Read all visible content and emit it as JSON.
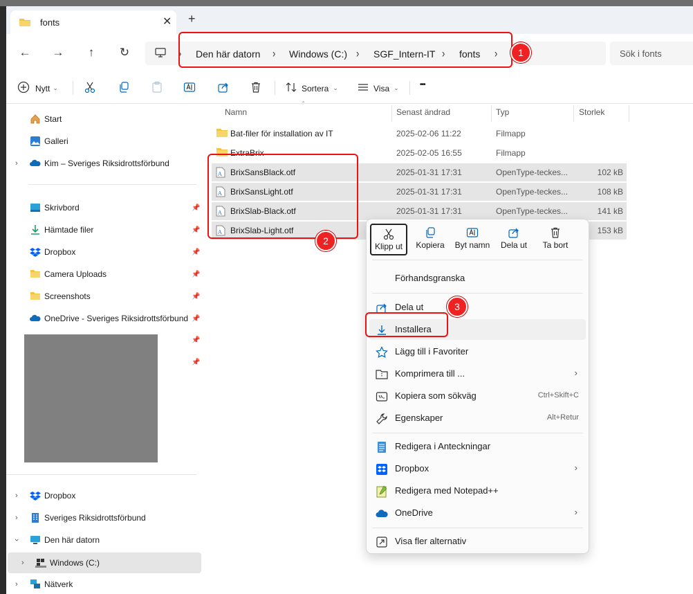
{
  "tab": {
    "title": "fonts",
    "close": "✕",
    "new": "+"
  },
  "address": {
    "crumbs": [
      "Den här datorn",
      "Windows (C:)",
      "SGF_Intern-IT",
      "fonts"
    ],
    "search_placeholder": "Sök i fonts"
  },
  "toolbar": {
    "new_label": "Nytt",
    "sort_label": "Sortera",
    "view_label": "Visa",
    "more": "•••"
  },
  "sidebar": {
    "items": [
      {
        "label": "Start",
        "icon": "home-icon"
      },
      {
        "label": "Galleri",
        "icon": "gallery-icon"
      },
      {
        "label": "Kim – Sveriges Riksidrottsförbund",
        "icon": "onedrive-icon"
      },
      {
        "label": "Skrivbord",
        "icon": "desktop-icon"
      },
      {
        "label": "Hämtade filer",
        "icon": "download-icon"
      },
      {
        "label": "Dropbox",
        "icon": "dropbox-icon"
      },
      {
        "label": "Camera Uploads",
        "icon": "folder-icon"
      },
      {
        "label": "Screenshots",
        "icon": "folder-icon"
      },
      {
        "label": "OneDrive - Sveriges Riksidrottsförbund",
        "icon": "onedrive-icon"
      },
      {
        "label": "Dropbox",
        "icon": "dropbox-icon"
      },
      {
        "label": "Sveriges Riksidrottsförbund",
        "icon": "building-icon"
      },
      {
        "label": "Den här datorn",
        "icon": "computer-icon"
      },
      {
        "label": "Windows (C:)",
        "icon": "drive-icon"
      },
      {
        "label": "Nätverk",
        "icon": "network-icon"
      }
    ]
  },
  "columns": {
    "name": "Namn",
    "modified": "Senast ändrad",
    "type": "Typ",
    "size": "Storlek"
  },
  "files": [
    {
      "name": "Bat-filer för installation av IT",
      "modified": "2025-02-06 11:22",
      "type": "Filmapp",
      "size": "",
      "kind": "folder"
    },
    {
      "name": "ExtraBrix",
      "modified": "2025-02-05 16:55",
      "type": "Filmapp",
      "size": "",
      "kind": "folder"
    },
    {
      "name": "BrixSansBlack.otf",
      "modified": "2025-01-31 17:31",
      "type": "OpenType-teckes...",
      "size": "102 kB",
      "kind": "font"
    },
    {
      "name": "BrixSansLight.otf",
      "modified": "2025-01-31 17:31",
      "type": "OpenType-teckes...",
      "size": "108 kB",
      "kind": "font"
    },
    {
      "name": "BrixSlab-Black.otf",
      "modified": "2025-01-31 17:31",
      "type": "OpenType-teckes...",
      "size": "141 kB",
      "kind": "font"
    },
    {
      "name": "BrixSlab-Light.otf",
      "modified": "",
      "type": "",
      "size": "153 kB",
      "kind": "font"
    }
  ],
  "context_menu": {
    "quick_actions": [
      "Klipp ut",
      "Kopiera",
      "Byt namn",
      "Dela ut",
      "Ta bort"
    ],
    "items": [
      {
        "label": "Förhandsgranska",
        "shortcut": ""
      },
      {
        "label": "Dela ut",
        "shortcut": ""
      },
      {
        "label": "Installera",
        "shortcut": ""
      },
      {
        "label": "Lägg till i Favoriter",
        "shortcut": ""
      },
      {
        "label": "Komprimera till ...",
        "shortcut": ""
      },
      {
        "label": "Kopiera som sökväg",
        "shortcut": "Ctrl+Skift+C"
      },
      {
        "label": "Egenskaper",
        "shortcut": "Alt+Retur"
      },
      {
        "label": "Redigera i Anteckningar",
        "shortcut": ""
      },
      {
        "label": "Dropbox",
        "shortcut": ""
      },
      {
        "label": "Redigera med Notepad++",
        "shortcut": ""
      },
      {
        "label": "OneDrive",
        "shortcut": ""
      },
      {
        "label": "Visa fler alternativ",
        "shortcut": ""
      }
    ]
  },
  "annotations": [
    "1",
    "2",
    "3"
  ],
  "colors": {
    "annotation": "#e11111",
    "folder": "#f3c43f",
    "accent": "#0067c0",
    "selected_row": "#e5e5e5"
  }
}
